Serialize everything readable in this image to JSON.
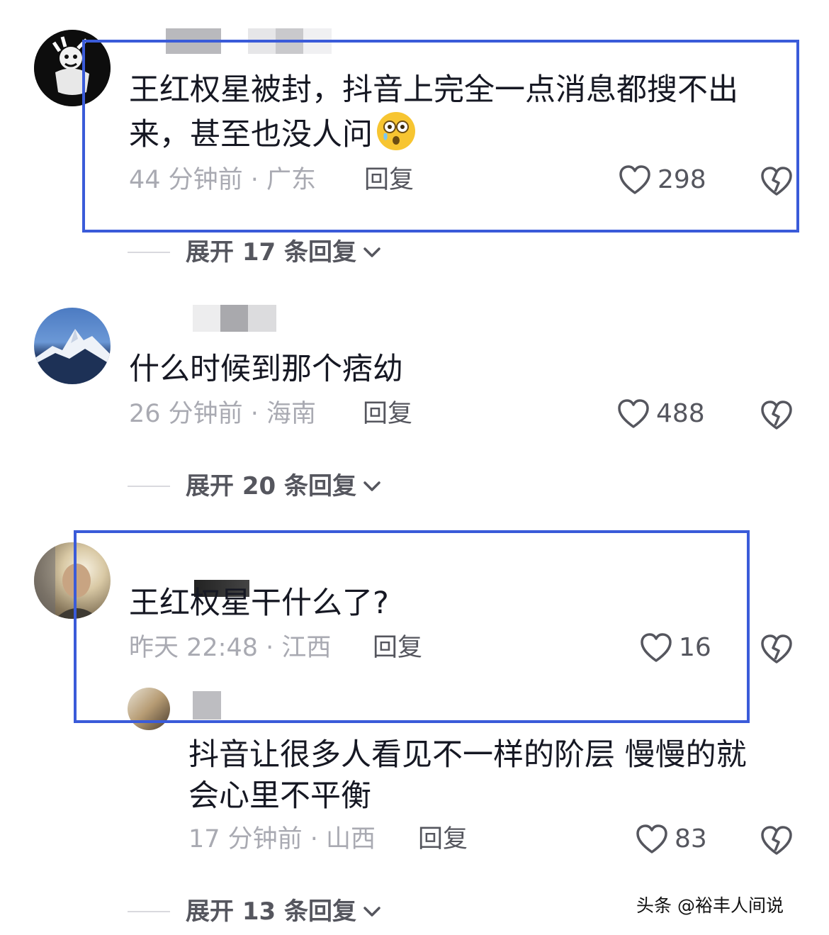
{
  "comments": [
    {
      "text_line1": "王红权星被封，抖音上完全一点消息都搜不出",
      "text_line2": "来，甚至也没人问",
      "emoji": "😳",
      "time_location": "44 分钟前 · 广东",
      "reply_label": "回复",
      "likes": "298",
      "expand_label": "展开 17 条回复"
    },
    {
      "text_line1": "什么时候到那个痞幼",
      "time_location": "26 分钟前 · 海南",
      "reply_label": "回复",
      "likes": "488",
      "expand_label": "展开 20 条回复"
    },
    {
      "text_line1": "王红权星干什么了?",
      "time_location": "昨天 22:48 · 江西",
      "reply_label": "回复",
      "likes": "16",
      "sub_reply": {
        "text_line1": "抖音让很多人看见不一样的阶层 慢慢的就",
        "text_line2": "会心里不平衡",
        "time_location": "17 分钟前 · 山西",
        "reply_label": "回复",
        "likes": "83"
      },
      "expand_label": "展开 13 条回复"
    }
  ],
  "watermark": "头条 @裕丰人间说",
  "colors": {
    "highlight_box": "#3a5bd9",
    "meta_gray": "#a9aab2",
    "dark_text": "#161823"
  }
}
